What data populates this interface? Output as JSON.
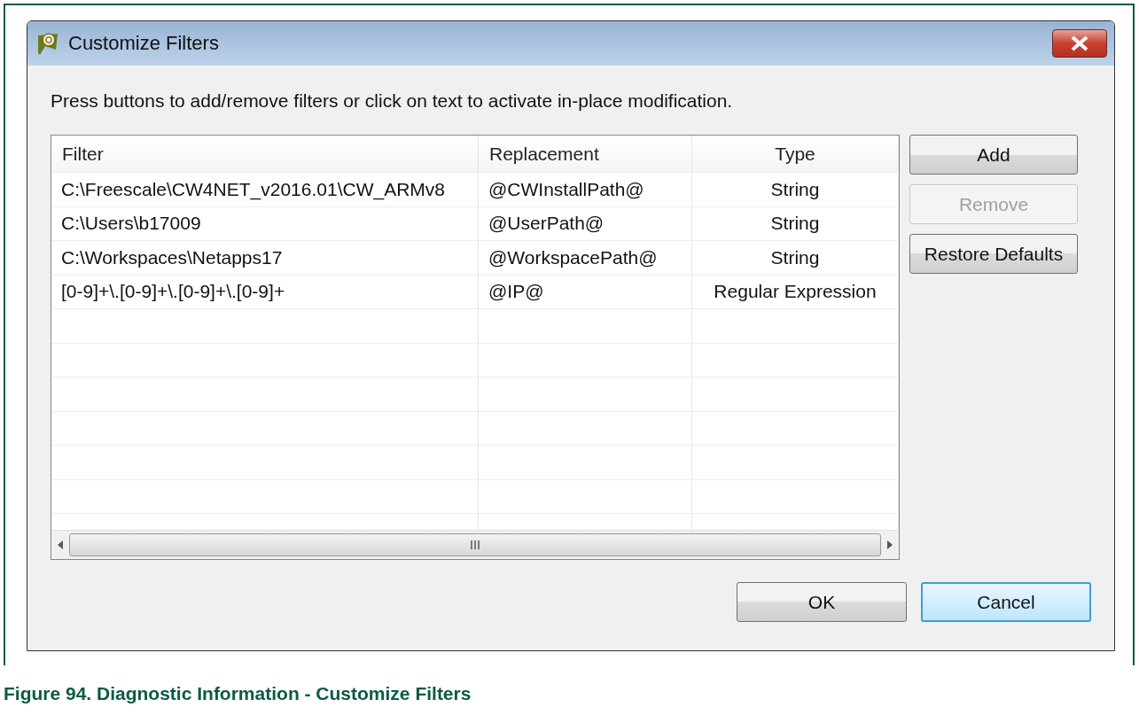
{
  "window": {
    "title": "Customize Filters"
  },
  "instruction": "Press buttons to add/remove filters or click on text to activate in-place modification.",
  "table": {
    "columns": [
      "Filter",
      "Replacement",
      "Type"
    ],
    "rows": [
      [
        "C:\\Freescale\\CW4NET_v2016.01\\CW_ARMv8",
        "@CWInstallPath@",
        "String"
      ],
      [
        "C:\\Users\\b17009",
        "@UserPath@",
        "String"
      ],
      [
        "C:\\Workspaces\\Netapps17",
        "@WorkspacePath@",
        "String"
      ],
      [
        "[0-9]+\\.[0-9]+\\.[0-9]+\\.[0-9]+",
        "@IP@",
        "Regular Expression"
      ]
    ]
  },
  "side_buttons": [
    {
      "label": "Add",
      "disabled": false
    },
    {
      "label": "Remove",
      "disabled": true
    },
    {
      "label": "Restore Defaults",
      "disabled": false
    }
  ],
  "dialog_buttons": [
    {
      "label": "OK",
      "focused": false
    },
    {
      "label": "Cancel",
      "focused": true
    }
  ],
  "caption": "Figure 94.  Diagnostic Information - Customize Filters"
}
